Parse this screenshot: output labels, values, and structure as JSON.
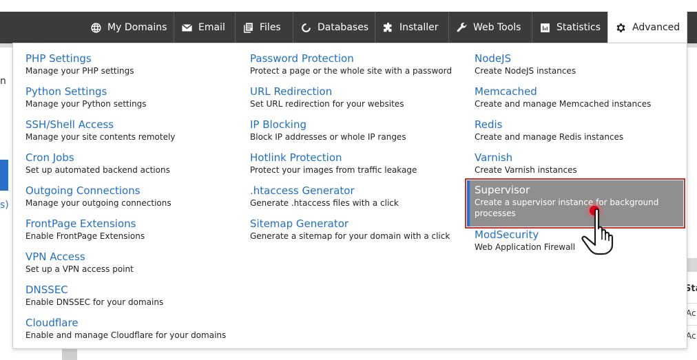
{
  "nav": {
    "tabs": [
      {
        "label": "My Domains",
        "icon": "globe-icon"
      },
      {
        "label": "Email",
        "icon": "envelope-icon"
      },
      {
        "label": "Files",
        "icon": "files-icon"
      },
      {
        "label": "Databases",
        "icon": "database-icon"
      },
      {
        "label": "Installer",
        "icon": "puzzle-icon"
      },
      {
        "label": "Web Tools",
        "icon": "wrench-icon"
      },
      {
        "label": "Statistics",
        "icon": "bar-chart-icon"
      },
      {
        "label": "Advanced",
        "icon": "gear-icon",
        "active": true
      }
    ]
  },
  "background": {
    "heading_fragment": "n",
    "link_fragment": "s)",
    "column_fragment": "Sta",
    "cell_fragment_1": "Ac",
    "cell_fragment_2": "Ac"
  },
  "menu": {
    "col1": [
      {
        "title": "PHP Settings",
        "desc": "Manage your PHP settings"
      },
      {
        "title": "Python Settings",
        "desc": "Manage your Python settings"
      },
      {
        "title": "SSH/Shell Access",
        "desc": "Manage your site contents remotely"
      },
      {
        "title": "Cron Jobs",
        "desc": "Set up automated backend actions"
      },
      {
        "title": "Outgoing Connections",
        "desc": "Manage your outgoing connections"
      },
      {
        "title": "FrontPage Extensions",
        "desc": "Enable FrontPage Extensions"
      },
      {
        "title": "VPN Access",
        "desc": "Set up a VPN access point"
      },
      {
        "title": "DNSSEC",
        "desc": "Enable DNSSEC for your domains"
      },
      {
        "title": "Cloudflare",
        "desc": "Enable and manage Cloudflare for your domains"
      }
    ],
    "col2": [
      {
        "title": "Password Protection",
        "desc": "Protect a page or the whole site with a password"
      },
      {
        "title": "URL Redirection",
        "desc": "Set URL redirection for your websites"
      },
      {
        "title": "IP Blocking",
        "desc": "Block IP addresses or whole IP ranges"
      },
      {
        "title": "Hotlink Protection",
        "desc": "Protect your images from traffic leakage"
      },
      {
        "title": ".htaccess Generator",
        "desc": "Generate .htaccess files with a click"
      },
      {
        "title": "Sitemap Generator",
        "desc": "Generate a sitemap for your domain with a click"
      }
    ],
    "col3": [
      {
        "title": "NodeJS",
        "desc": "Create NodeJS instances"
      },
      {
        "title": "Memcached",
        "desc": "Create and manage Memcached instances"
      },
      {
        "title": "Redis",
        "desc": "Create and manage Redis instances"
      },
      {
        "title": "Varnish",
        "desc": "Create Varnish instances"
      },
      {
        "title": "Supervisor",
        "desc": "Create a supervisor instance for background processes",
        "highlighted": true
      },
      {
        "title": "ModSecurity",
        "desc": "Web Application Firewall"
      }
    ]
  },
  "colors": {
    "topbar": "#3b3b3b",
    "link": "#1f6fc5",
    "highlight_bg": "#8f8f8f",
    "highlight_outline": "#c8302c",
    "click_marker": "#e0001a"
  }
}
